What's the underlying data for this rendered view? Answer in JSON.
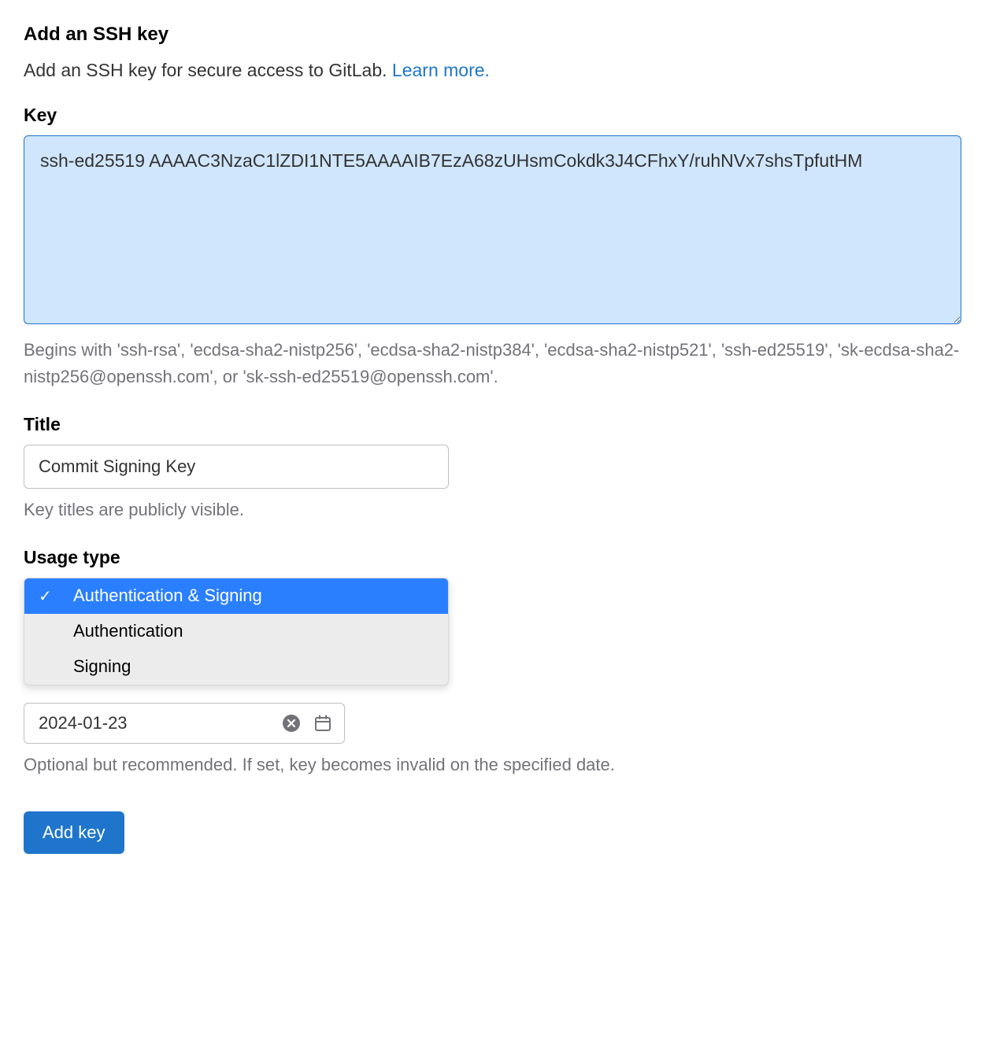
{
  "header": {
    "title": "Add an SSH key",
    "description": "Add an SSH key for secure access to GitLab. ",
    "learn_more": "Learn more."
  },
  "key": {
    "label": "Key",
    "value": "ssh-ed25519 AAAAC3NzaC1lZDI1NTE5AAAAIB7EzA68zUHsmCokdk3J4CFhxY/ruhNVx7shsTpfutHM",
    "help": "Begins with 'ssh-rsa', 'ecdsa-sha2-nistp256', 'ecdsa-sha2-nistp384', 'ecdsa-sha2-nistp521', 'ssh-ed25519', 'sk-ecdsa-sha2-nistp256@openssh.com', or 'sk-ssh-ed25519@openssh.com'."
  },
  "title_field": {
    "label": "Title",
    "value": "Commit Signing Key",
    "help": "Key titles are publicly visible."
  },
  "usage": {
    "label": "Usage type",
    "options": {
      "auth_signing": "Authentication & Signing",
      "auth": "Authentication",
      "signing": "Signing"
    }
  },
  "expiration": {
    "value": "2024-01-23",
    "help": "Optional but recommended. If set, key becomes invalid on the specified date."
  },
  "actions": {
    "add_key": "Add key"
  }
}
